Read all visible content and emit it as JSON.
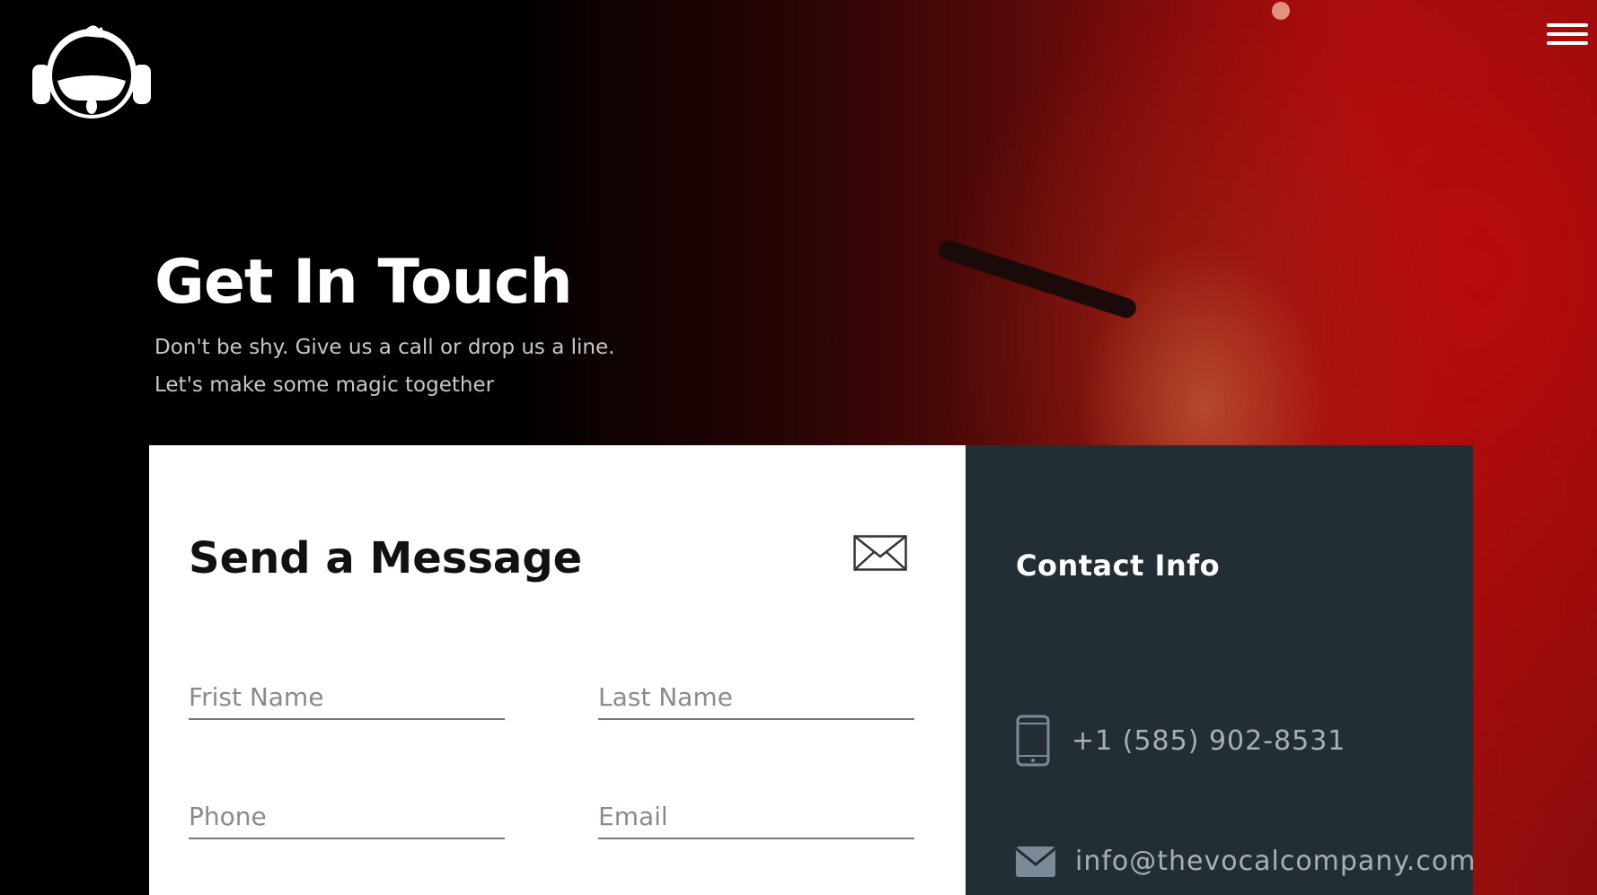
{
  "header": {
    "logo_name": "headphone-mascot-logo",
    "menu_icon": "hamburger-menu-icon"
  },
  "hero": {
    "title": "Get In Touch",
    "subtitle_line1": "Don't be shy. Give us a call or drop us a line.",
    "subtitle_line2": "Let's make some magic together"
  },
  "form": {
    "title": "Send a Message",
    "title_icon": "envelope-outline-icon",
    "fields": {
      "first_name": {
        "placeholder": "Frist Name",
        "value": ""
      },
      "last_name": {
        "placeholder": "Last Name",
        "value": ""
      },
      "phone": {
        "placeholder": "Phone",
        "value": ""
      },
      "email": {
        "placeholder": "Email",
        "value": ""
      }
    }
  },
  "contact": {
    "title": "Contact Info",
    "phone": {
      "icon": "mobile-phone-icon",
      "text": "+1 (585) 902-8531"
    },
    "email": {
      "icon": "envelope-filled-icon",
      "text": "info@thevocalcompany.com"
    }
  },
  "colors": {
    "panel_dark": "#232d34",
    "hero_red": "#a10f0f",
    "muted_text": "#a9b0b5"
  }
}
